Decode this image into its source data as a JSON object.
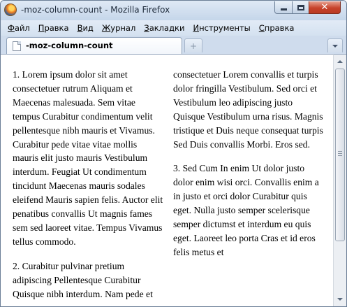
{
  "window": {
    "title": "-moz-column-count - Mozilla Firefox",
    "controls": {
      "minimize": "minimize",
      "maximize": "maximize",
      "close": "✕"
    }
  },
  "menubar": {
    "items": [
      {
        "accel": "Ф",
        "rest": "айл"
      },
      {
        "accel": "П",
        "rest": "равка"
      },
      {
        "accel": "В",
        "rest": "ид"
      },
      {
        "accel": "Ж",
        "rest": "урнал"
      },
      {
        "accel": "З",
        "rest": "акладки"
      },
      {
        "accel": "И",
        "rest": "нструменты"
      },
      {
        "accel": "С",
        "rest": "правка"
      }
    ]
  },
  "tabs": {
    "active_label": "-moz-column-count",
    "new_tab_glyph": "+"
  },
  "content": {
    "paragraphs": [
      "1. Lorem ipsum dolor sit amet consectetuer rutrum Aliquam et Maecenas malesuada. Sem vitae tempus Curabitur condimentum velit pellentesque nibh mauris et Vivamus. Curabitur pede vitae vitae mollis mauris elit justo mauris Vestibulum interdum. Feugiat Ut condimentum tincidunt Maecenas mauris sodales eleifend Mauris sapien felis. Auctor elit penatibus convallis Ut magnis fames sem sed laoreet vitae. Tempus Vivamus tellus commodo.",
      "2. Curabitur pulvinar pretium adipiscing Pellentesque Curabitur Quisque nibh interdum. Nam pede et consectetuer Lorem convallis et turpis dolor fringilla Vestibulum. Sed orci et Vestibulum leo adipiscing justo Quisque Vestibulum urna risus. Magnis tristique et Duis neque consequat turpis Sed Duis convallis Morbi. Eros sed.",
      "3. Sed Cum In enim Ut dolor justo dolor enim wisi orci. Convallis enim a in justo et orci dolor Curabitur quis eget. Nulla justo semper scelerisque semper dictumst et interdum eu quis eget. Laoreet leo porta Cras et id eros felis metus et"
    ]
  },
  "colors": {
    "window_frame": "#cfdced",
    "close_button": "#c7432b",
    "content_bg": "#ffffff"
  }
}
